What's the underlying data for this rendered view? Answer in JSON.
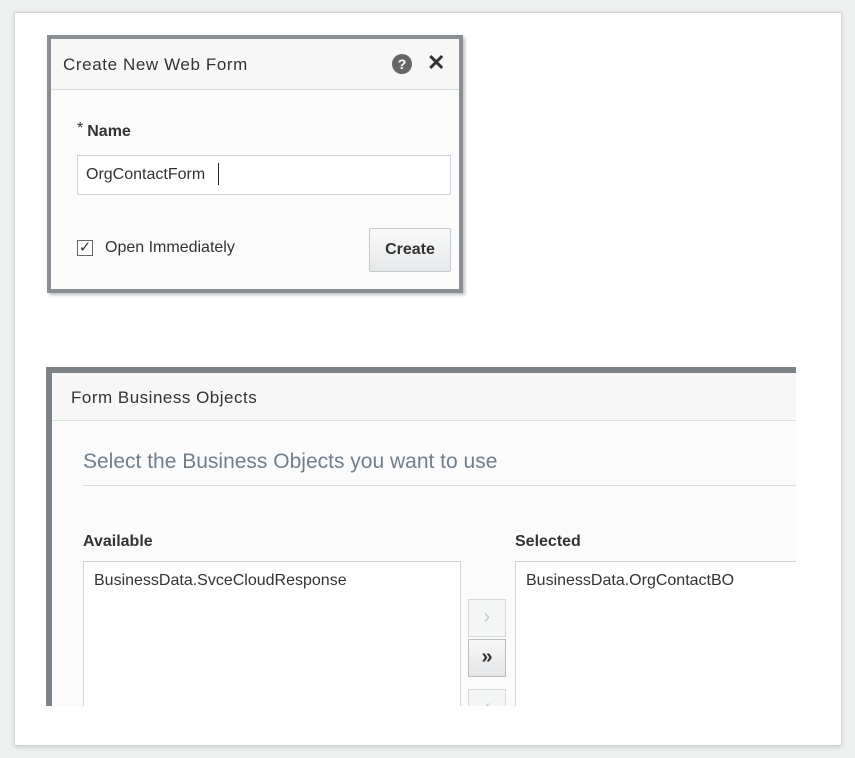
{
  "create_dialog": {
    "title": "Create New Web Form",
    "help_icon": "help-icon",
    "help_glyph": "?",
    "close_glyph": "✕",
    "name_required_mark": "*",
    "name_label": "Name",
    "name_value": "OrgContactForm",
    "open_immediately_checked": true,
    "checkbox_glyph": "✓",
    "open_immediately_label": "Open Immediately",
    "create_label": "Create"
  },
  "business_objects_dialog": {
    "title": "Form Business Objects",
    "subtitle": "Select the Business Objects you want to use",
    "available_label": "Available",
    "selected_label": "Selected",
    "available_items": [
      "BusinessData.SvceCloudResponse"
    ],
    "selected_items": [
      "BusinessData.OrgContactBO"
    ],
    "move_right_glyph": "›",
    "move_all_right_glyph": "»",
    "move_left_glyph": "‹"
  }
}
